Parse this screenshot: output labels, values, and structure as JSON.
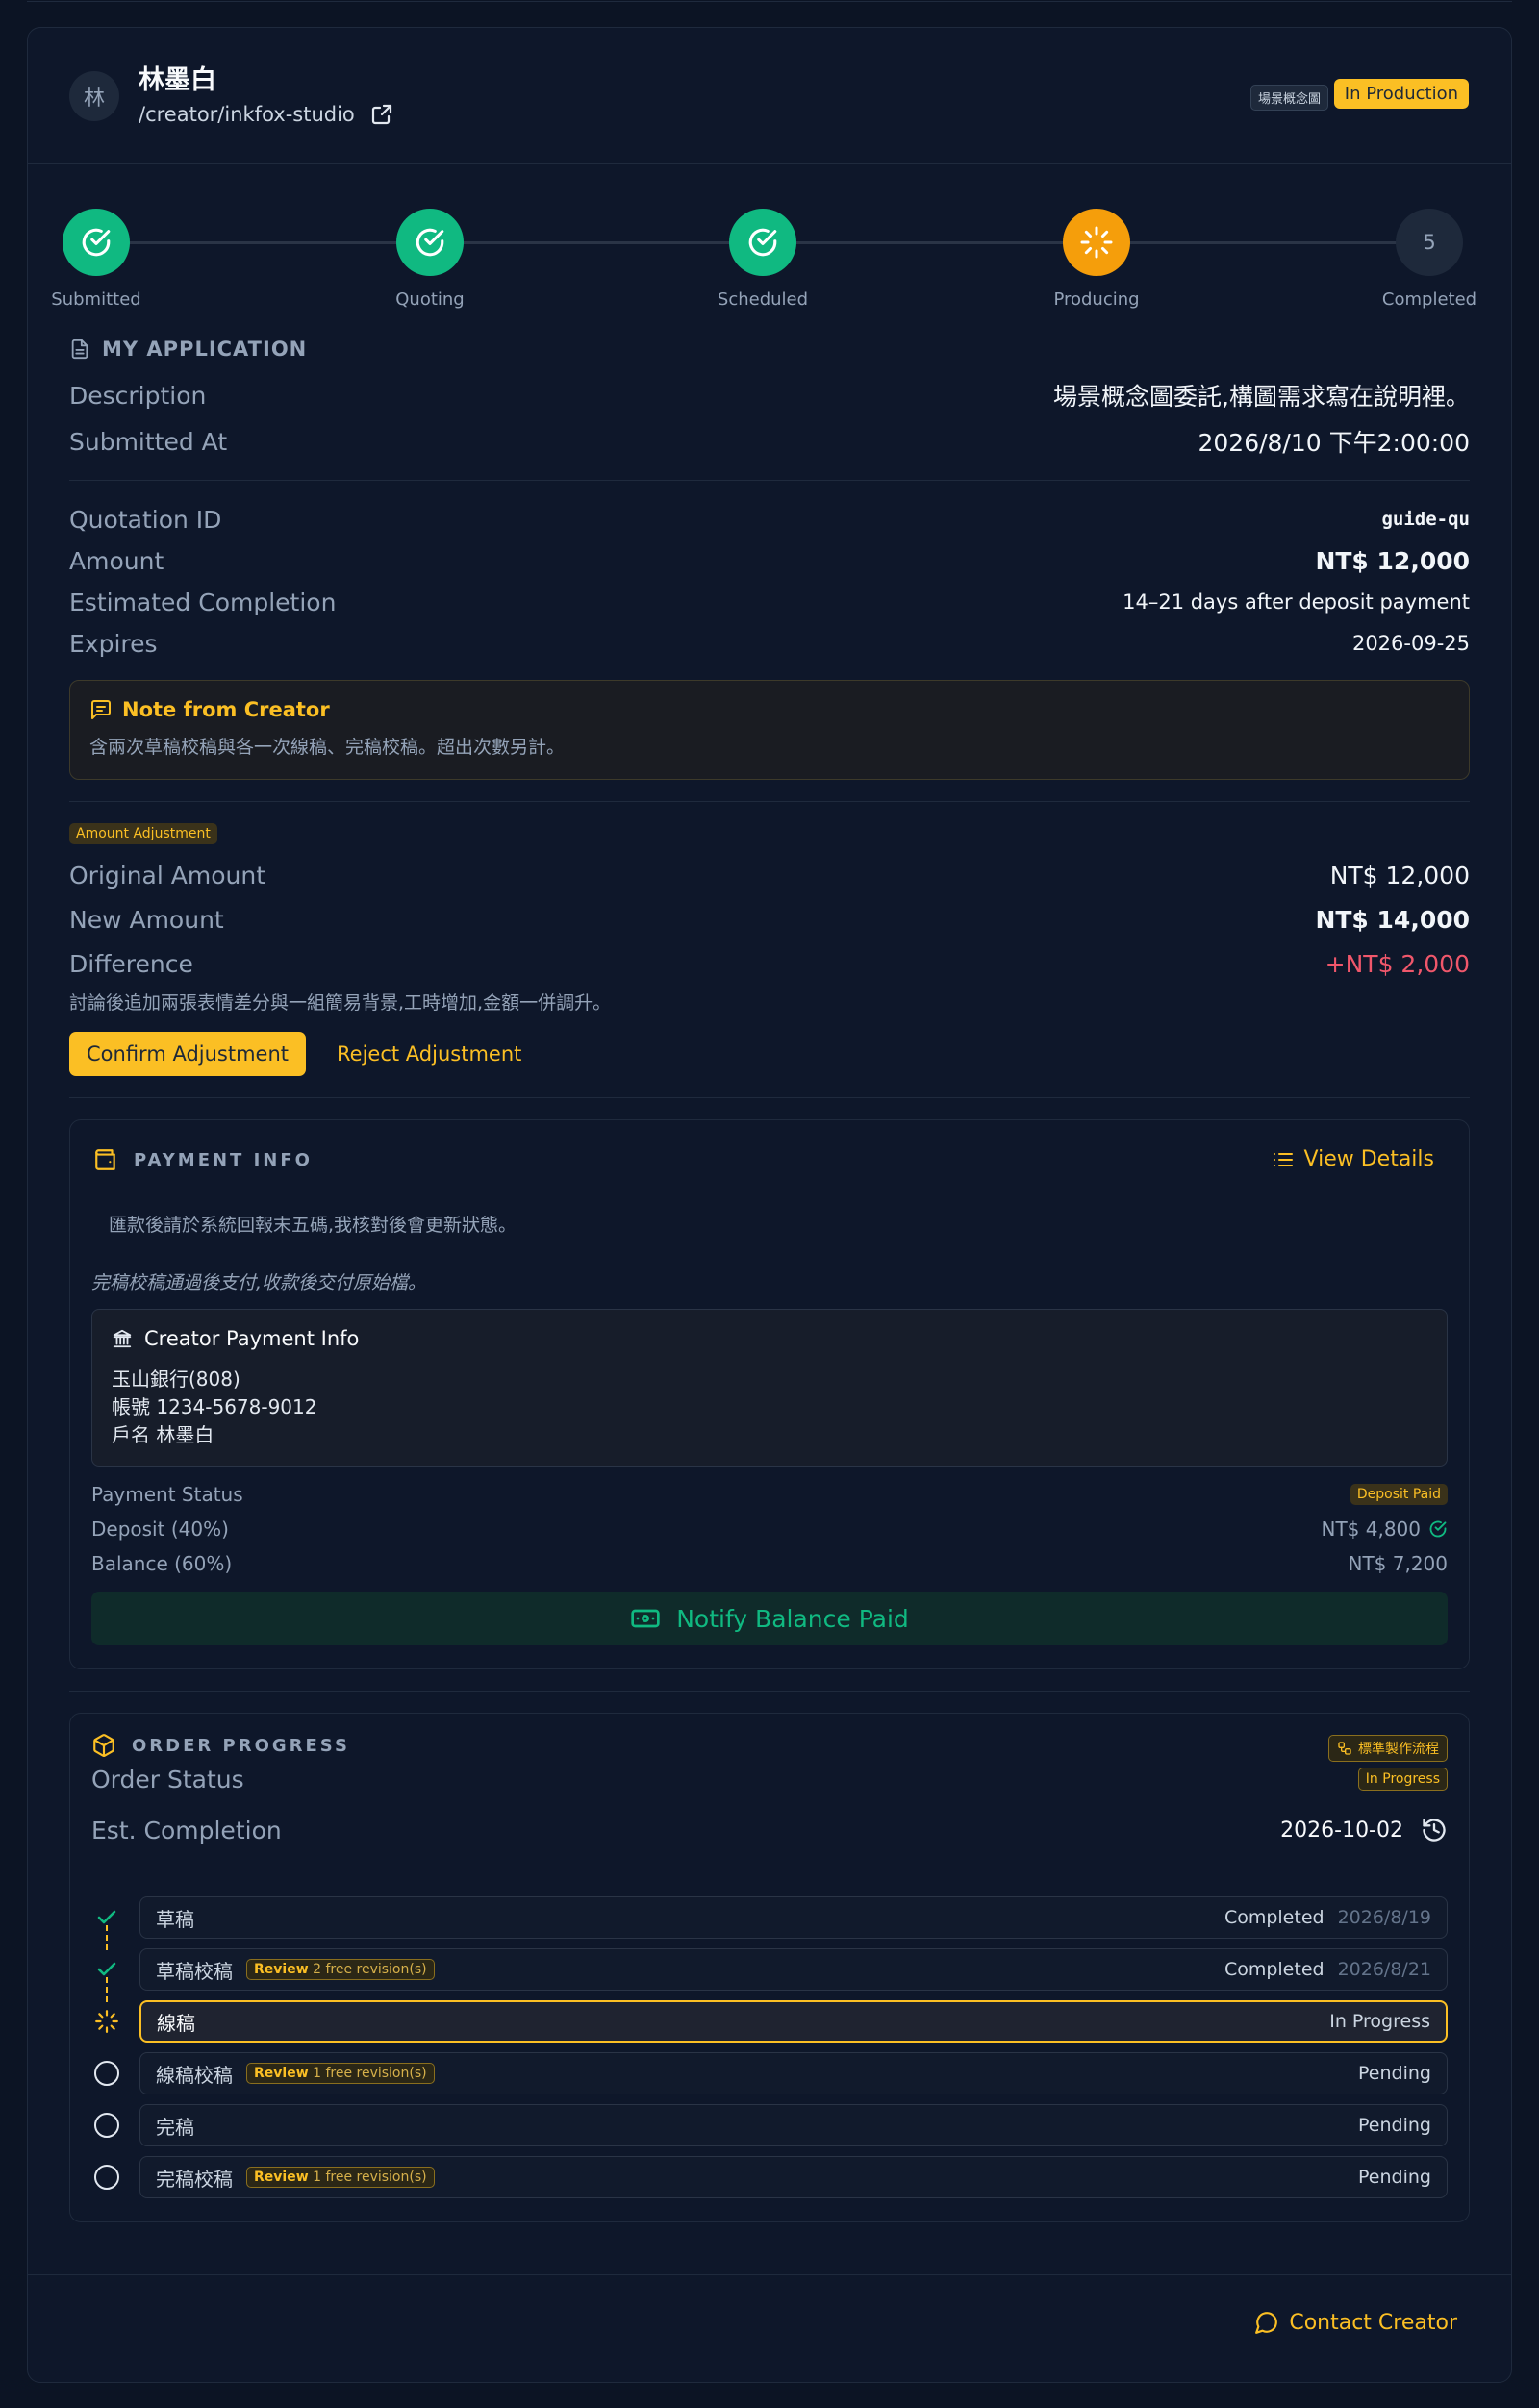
{
  "header": {
    "avatar_initial": "林",
    "creator_name": "林墨白",
    "creator_path": "/creator/inkfox-studio",
    "category_badge": "場景概念圖",
    "status_badge": "In Production"
  },
  "steps": [
    {
      "label": "Submitted",
      "state": "done"
    },
    {
      "label": "Quoting",
      "state": "done"
    },
    {
      "label": "Scheduled",
      "state": "done"
    },
    {
      "label": "Producing",
      "state": "current"
    },
    {
      "label": "Completed",
      "state": "pending",
      "number": "5"
    }
  ],
  "application": {
    "title": "MY APPLICATION",
    "description_label": "Description",
    "description_value": "場景概念圖委託,構圖需求寫在說明裡。",
    "submitted_label": "Submitted At",
    "submitted_value": "2026/8/10 下午2:00:00"
  },
  "quotation": {
    "id_label": "Quotation ID",
    "id_value": "guide-qu",
    "amount_label": "Amount",
    "amount_value": "NT$ 12,000",
    "est_label": "Estimated Completion",
    "est_value": "14–21 days after deposit payment",
    "expires_label": "Expires",
    "expires_value": "2026-09-25",
    "note_title": "Note from Creator",
    "note_body": "含兩次草稿校稿與各一次線稿、完稿校稿。超出次數另計。"
  },
  "adjustment": {
    "tag": "Amount Adjustment",
    "original_label": "Original Amount",
    "original_value": "NT$ 12,000",
    "new_label": "New Amount",
    "new_value": "NT$ 14,000",
    "diff_label": "Difference",
    "diff_value": "+NT$ 2,000",
    "reason": "討論後追加兩張表情差分與一組簡易背景,工時增加,金額一併調升。",
    "confirm_label": "Confirm Adjustment",
    "reject_label": "Reject Adjustment"
  },
  "payment": {
    "title": "PAYMENT INFO",
    "view_details": "View Details",
    "instruction": "匯款後請於系統回報末五碼,我核對後會更新狀態。",
    "terms": "完稿校稿通過後支付,收款後交付原始檔。",
    "box_title": "Creator Payment Info",
    "bank": "玉山銀行(808)",
    "account": "帳號 1234-5678-9012",
    "holder": "戶名 林墨白",
    "status_label": "Payment Status",
    "status_value": "Deposit Paid",
    "deposit_label": "Deposit (40%)",
    "deposit_value": "NT$ 4,800",
    "balance_label": "Balance (60%)",
    "balance_value": "NT$ 7,200",
    "notify_label": "Notify Balance Paid"
  },
  "progress": {
    "title": "ORDER PROGRESS",
    "workflow_badge": "標準製作流程",
    "status_label": "Order Status",
    "status_value": "In Progress",
    "est_label": "Est. Completion",
    "est_value": "2026-10-02",
    "stages": [
      {
        "name": "草稿",
        "review": "",
        "revisions": "",
        "status": "Completed",
        "date": "2026/8/19",
        "state": "done"
      },
      {
        "name": "草稿校稿",
        "review": "Review",
        "revisions": "2 free revision(s)",
        "status": "Completed",
        "date": "2026/8/21",
        "state": "done"
      },
      {
        "name": "線稿",
        "review": "",
        "revisions": "",
        "status": "In Progress",
        "date": "",
        "state": "current"
      },
      {
        "name": "線稿校稿",
        "review": "Review",
        "revisions": "1 free revision(s)",
        "status": "Pending",
        "date": "",
        "state": "pending"
      },
      {
        "name": "完稿",
        "review": "",
        "revisions": "",
        "status": "Pending",
        "date": "",
        "state": "pending"
      },
      {
        "name": "完稿校稿",
        "review": "Review",
        "revisions": "1 free revision(s)",
        "status": "Pending",
        "date": "",
        "state": "pending"
      }
    ]
  },
  "footer": {
    "contact_label": "Contact Creator"
  },
  "colors": {
    "accent": "#fbbf24",
    "success": "#10b981",
    "danger": "#f0576b",
    "bg": "#0e172a"
  }
}
